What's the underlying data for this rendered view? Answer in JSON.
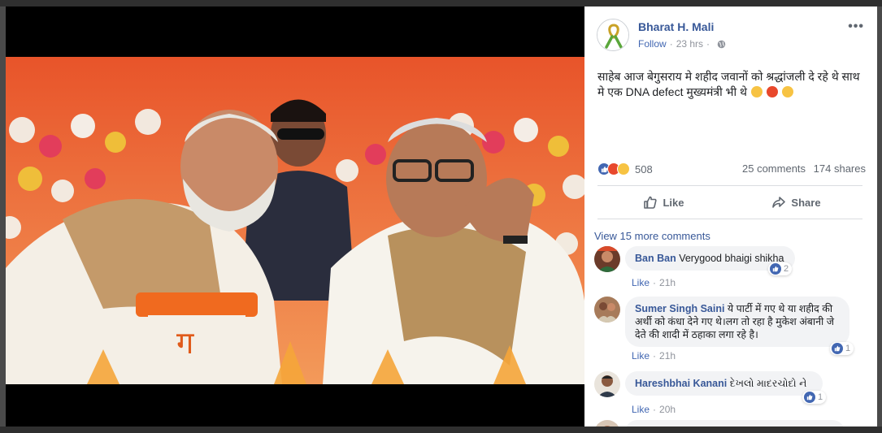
{
  "post": {
    "author": "Bharat H. Mali",
    "follow_label": "Follow",
    "separator": "·",
    "time": "23 hrs",
    "more_label": "•••",
    "text": "साहेब आज बेगुसराय मे शहीद जवानों को श्रद्धांजली दे रहे थे साथ मे एक DNA defect मुख्यमंत्री भी थे",
    "reaction_count": "508",
    "comments_count": "25 comments",
    "shares_count": "174 shares",
    "like_label": "Like",
    "share_label": "Share"
  },
  "comments_section": {
    "view_more": "View 15 more comments",
    "items": [
      {
        "name": "Ban Ban",
        "text": "Verygood bhaigi shikha",
        "like_label": "Like",
        "time": "21h",
        "reactions": "2"
      },
      {
        "name": "Sumer Singh Saini",
        "text": "ये पार्टी में गए थे या शहीद की अर्थी को कंधा देने गए थे।लग तो रहा है मुकेश अंबानी जे देते की शादी में ठहाका लगा रहे है।",
        "like_label": "Like",
        "time": "21h",
        "reactions": "1"
      },
      {
        "name": "Hareshbhai Kanani",
        "text": "દેખલો માદરચોદો ને",
        "like_label": "Like",
        "time": "20h",
        "reactions": "1"
      }
    ]
  },
  "icons": [
    "globe-icon",
    "like-icon",
    "share-icon",
    "ellipsis-icon",
    "ribbon-avatar-icon"
  ],
  "colors": {
    "link_blue": "#385898",
    "facebook_blue": "#4267b2",
    "muted": "#90949c",
    "bubble": "#f2f3f5"
  }
}
